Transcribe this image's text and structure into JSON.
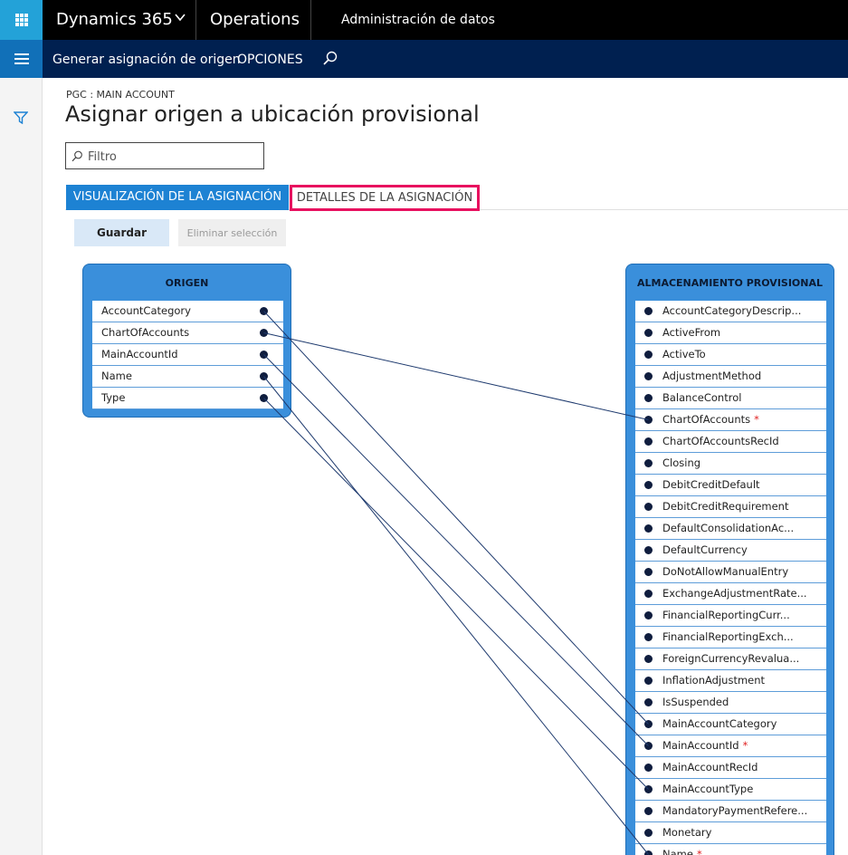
{
  "topbar": {
    "brand": "Dynamics 365",
    "module": "Operations",
    "area": "Administración de datos"
  },
  "actionbar": {
    "generate_label": "Generar asignación de origen",
    "options_label": "OPCIONES"
  },
  "page": {
    "breadcrumb": "PGC : MAIN ACCOUNT",
    "title": "Asignar origen a ubicación provisional",
    "filter_placeholder": "Filtro"
  },
  "tabs": {
    "visualization": "VISUALIZACIÓN DE LA ASIGNACIÓN",
    "details": "DETALLES DE LA ASIGNACIÓN"
  },
  "buttons": {
    "save": "Guardar",
    "delete_selection": "Eliminar selección"
  },
  "source": {
    "title": "ORIGEN",
    "fields": [
      {
        "name": "AccountCategory"
      },
      {
        "name": "ChartOfAccounts"
      },
      {
        "name": "MainAccountId"
      },
      {
        "name": "Name"
      },
      {
        "name": "Type"
      }
    ]
  },
  "staging": {
    "title": "ALMACENAMIENTO PROVISIONAL",
    "fields": [
      {
        "name": "AccountCategoryDescrip...",
        "required": false
      },
      {
        "name": "ActiveFrom",
        "required": false
      },
      {
        "name": "ActiveTo",
        "required": false
      },
      {
        "name": "AdjustmentMethod",
        "required": false
      },
      {
        "name": "BalanceControl",
        "required": false
      },
      {
        "name": "ChartOfAccounts",
        "required": true
      },
      {
        "name": "ChartOfAccountsRecId",
        "required": false
      },
      {
        "name": "Closing",
        "required": false
      },
      {
        "name": "DebitCreditDefault",
        "required": false
      },
      {
        "name": "DebitCreditRequirement",
        "required": false
      },
      {
        "name": "DefaultConsolidationAc...",
        "required": false
      },
      {
        "name": "DefaultCurrency",
        "required": false
      },
      {
        "name": "DoNotAllowManualEntry",
        "required": false
      },
      {
        "name": "ExchangeAdjustmentRate...",
        "required": false
      },
      {
        "name": "FinancialReportingCurr...",
        "required": false
      },
      {
        "name": "FinancialReportingExch...",
        "required": false
      },
      {
        "name": "ForeignCurrencyRevalua...",
        "required": false
      },
      {
        "name": "InflationAdjustment",
        "required": false
      },
      {
        "name": "IsSuspended",
        "required": false
      },
      {
        "name": "MainAccountCategory",
        "required": false
      },
      {
        "name": "MainAccountId",
        "required": true
      },
      {
        "name": "MainAccountRecId",
        "required": false
      },
      {
        "name": "MainAccountType",
        "required": false
      },
      {
        "name": "MandatoryPaymentRefere...",
        "required": false
      },
      {
        "name": "Monetary",
        "required": false
      },
      {
        "name": "Name",
        "required": true
      }
    ],
    "required_mark": "*"
  },
  "mappings": [
    {
      "source": "AccountCategory",
      "staging": "MainAccountCategory"
    },
    {
      "source": "ChartOfAccounts",
      "staging": "ChartOfAccounts"
    },
    {
      "source": "MainAccountId",
      "staging": "MainAccountId"
    },
    {
      "source": "Name",
      "staging": "Name"
    },
    {
      "source": "Type",
      "staging": "MainAccountType"
    }
  ],
  "colors": {
    "accent": "#1d82d3",
    "waffle": "#23a2d8",
    "actionbar": "#002050",
    "highlight_border": "#e8115f",
    "connector": "#1e3a6e"
  }
}
